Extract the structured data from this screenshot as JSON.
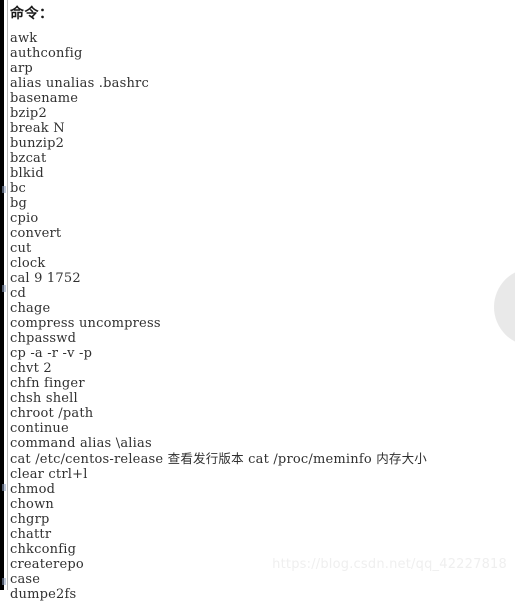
{
  "heading": "命令：",
  "commands": [
    "awk",
    "authconfig",
    "arp",
    "alias unalias .bashrc",
    "basename",
    "bzip2",
    "break N",
    "bunzip2",
    "bzcat",
    "blkid",
    "bc",
    "bg",
    "cpio",
    "convert",
    "cut",
    "clock",
    "cal 9 1752",
    "cd",
    "chage",
    "compress uncompress",
    "chpasswd",
    "cp -a -r -v -p",
    "chvt 2",
    "chfn finger",
    "chsh shell",
    "chroot /path",
    "continue",
    "command alias \\alias",
    "cat /etc/centos-release 查看发行版本 cat /proc/meminfo 内存大小",
    "clear ctrl+l",
    "chmod",
    "chown",
    "chgrp",
    "chattr",
    "chkconfig",
    "createrepo",
    "case",
    "dumpe2fs"
  ],
  "watermark": "https://blog.csdn.net/qq_42227818",
  "colors": {
    "text": "#303030",
    "heading": "#1a1a1a",
    "rule": "#b9b9b9",
    "edge_bar": "#000000",
    "circle": "#e9e9e9",
    "watermark": "#efefef",
    "background": "#ffffff"
  }
}
